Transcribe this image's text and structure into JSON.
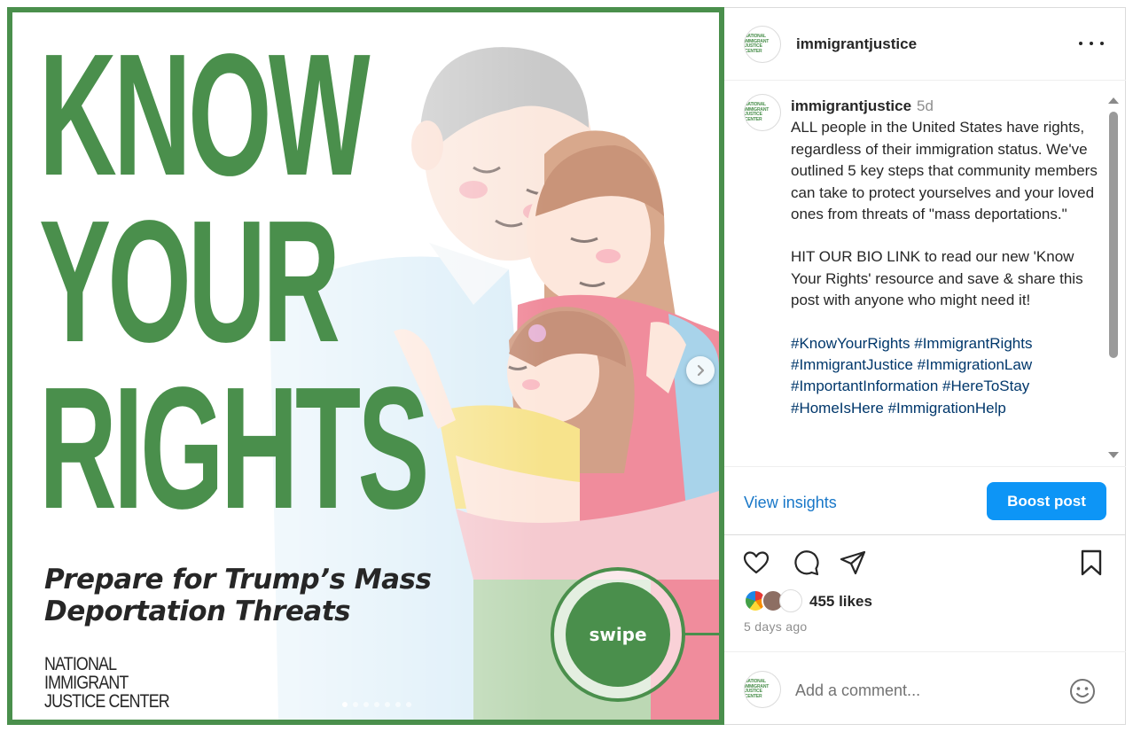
{
  "post_image": {
    "headline_lines": [
      "KNOW",
      "YOUR",
      "RIGHTS"
    ],
    "subhead_lines": [
      "Prepare for Trump’s Mass",
      "Deportation Threats"
    ],
    "org_logo_lines": [
      "NATIONAL",
      "IMMIGRANT",
      "JUSTICE CENTER"
    ],
    "swipe_label": "swipe",
    "next_icon": "chevron-right-icon",
    "carousel_dots": 7,
    "colors": {
      "brand_green": "#4a8f4c",
      "text_dark": "#262626"
    }
  },
  "profile": {
    "username": "immigrantjustice",
    "avatar_text": [
      "NATIONAL",
      "IMMIGRANT",
      "JUSTICE CENTER"
    ]
  },
  "header": {
    "more_icon": "more-horizontal-icon"
  },
  "caption": {
    "author": "immigrantjustice",
    "time": "5d",
    "paragraph_1": "ALL people in the United States have rights, regardless of their immigration status. We've outlined 5 key steps that community members can take to protect yourselves and your loved ones from threats of \"mass deportations.\"",
    "paragraph_2": "HIT OUR BIO LINK to read our new 'Know Your Rights' resource and save & share this post with anyone who might need it!",
    "hashtags_1": "#KnowYourRights #ImmigrantRights",
    "hashtags_2": "#ImmigrantJustice #ImmigrationLaw",
    "hashtags_3": "#ImportantInformation #HereToStay",
    "hashtags_4": "#HomeIsHere #ImmigrationHelp"
  },
  "insights": {
    "view_insights_label": "View insights",
    "boost_label": "Boost post",
    "colors": {
      "link_blue": "#1877c8",
      "button_blue": "#0d95f6"
    }
  },
  "actions": {
    "icons": [
      "heart-icon",
      "comment-icon",
      "share-icon",
      "bookmark-icon"
    ],
    "likes_text": "455 likes",
    "post_time": "5 days ago"
  },
  "comment": {
    "placeholder": "Add a comment...",
    "emoji_icon": "emoji-icon"
  }
}
